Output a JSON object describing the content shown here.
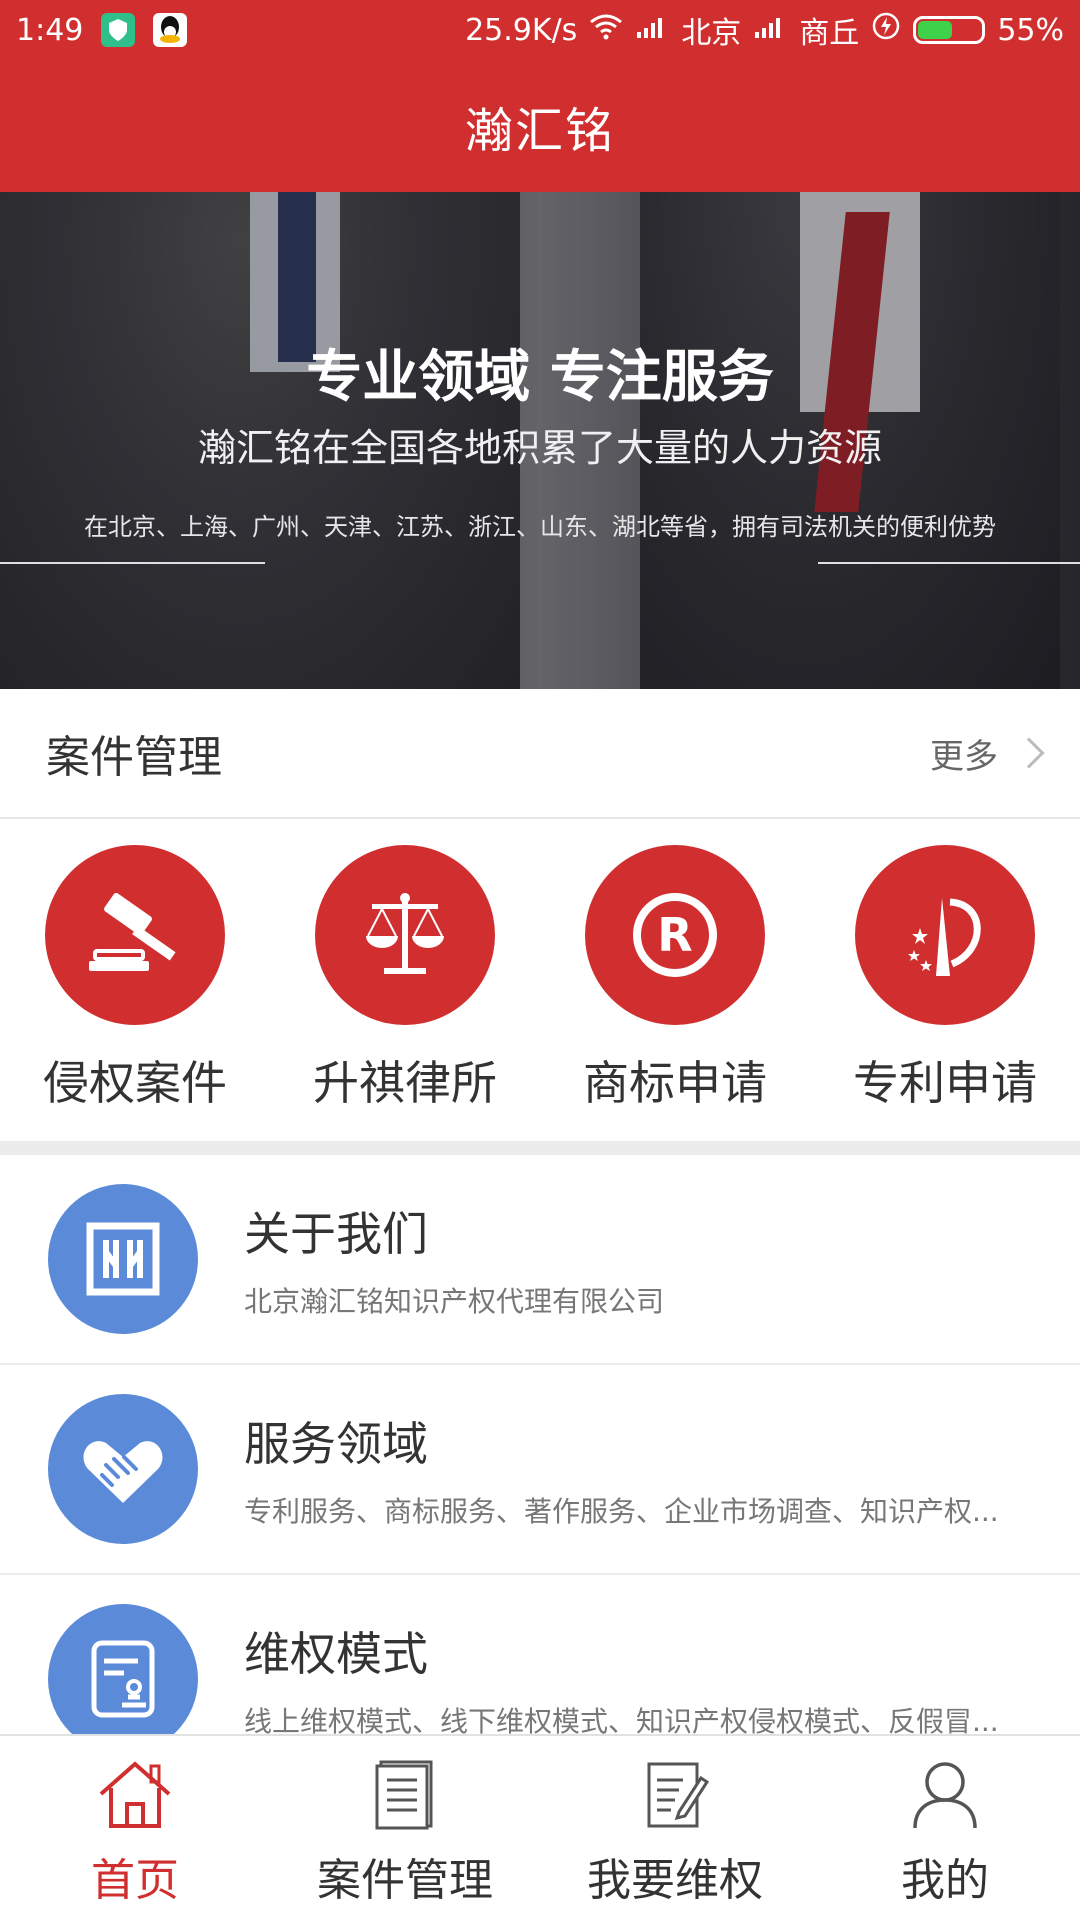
{
  "status_bar": {
    "time": "1:49",
    "network_speed": "25.9K/s",
    "carrier1": "北京",
    "carrier2": "商丘",
    "battery": "55%",
    "battery_level": 0.55
  },
  "app_bar": {
    "title": "瀚汇铭"
  },
  "banner": {
    "headline": "专业领域 专注服务",
    "subtitle": "瀚汇铭在全国各地积累了大量的人力资源",
    "detail": "在北京、上海、广州、天津、江苏、浙江、山东、湖北等省，拥有司法机关的便利优势"
  },
  "section": {
    "title": "案件管理",
    "more": "更多"
  },
  "categories": [
    {
      "label": "侵权案件",
      "icon": "gavel-icon"
    },
    {
      "label": "升祺律所",
      "icon": "scales-icon"
    },
    {
      "label": "商标申请",
      "icon": "registered-icon"
    },
    {
      "label": "专利申请",
      "icon": "patent-icon"
    }
  ],
  "list": [
    {
      "title": "关于我们",
      "desc": "北京瀚汇铭知识产权代理有限公司",
      "icon": "company-logo-icon"
    },
    {
      "title": "服务领域",
      "desc": "专利服务、商标服务、著作服务、企业市场调查、知识产权...",
      "icon": "handshake-icon"
    },
    {
      "title": "维权模式",
      "desc": "线上维权模式、线下维权模式、知识产权侵权模式、反假冒...",
      "icon": "certificate-icon"
    }
  ],
  "bottom_nav": [
    {
      "label": "首页",
      "icon": "home-icon",
      "active": true
    },
    {
      "label": "案件管理",
      "icon": "document-icon",
      "active": false
    },
    {
      "label": "我要维权",
      "icon": "edit-document-icon",
      "active": false
    },
    {
      "label": "我的",
      "icon": "user-icon",
      "active": false
    }
  ],
  "colors": {
    "primary": "#d12f2f",
    "list_icon": "#5b8bd8"
  }
}
